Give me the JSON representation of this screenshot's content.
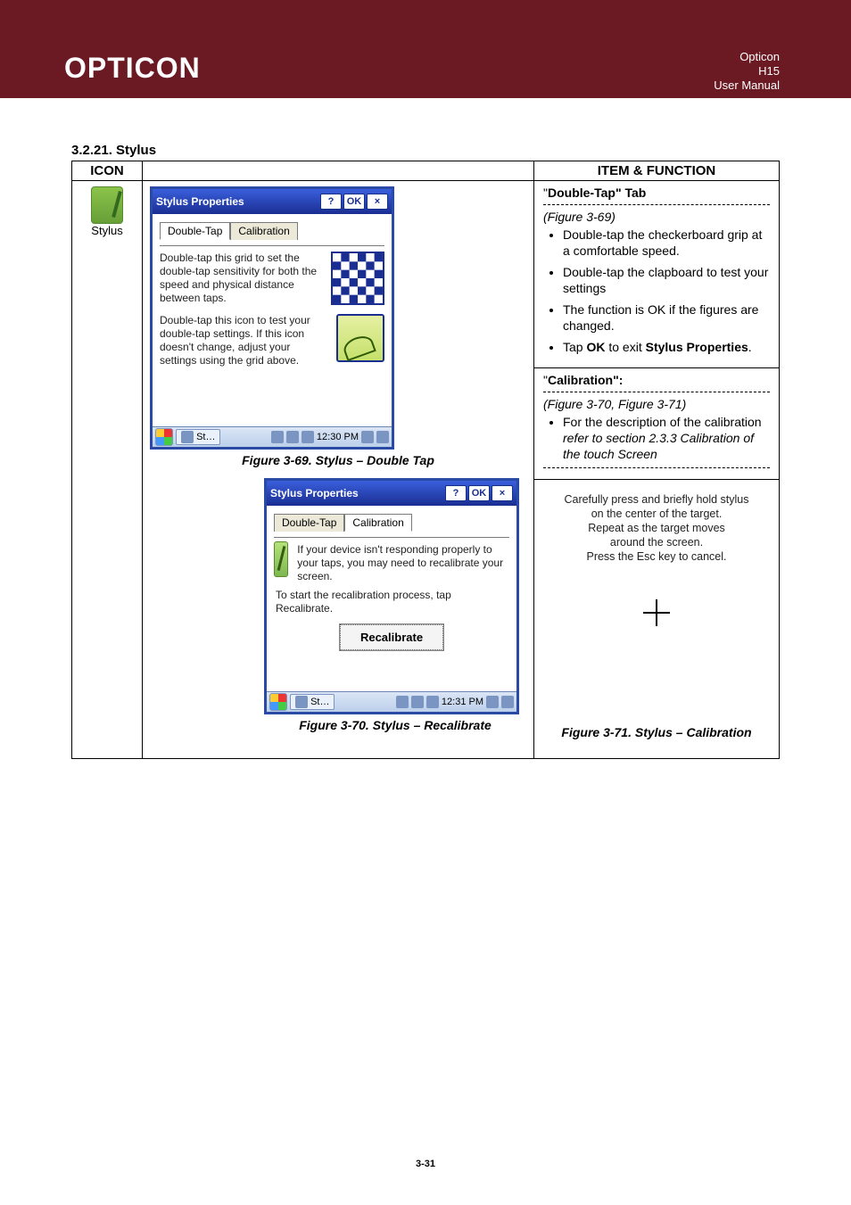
{
  "header": {
    "logo_text": "OPTICON",
    "brand": "Opticon",
    "model": "H15",
    "doc_type": "User Manual"
  },
  "section": {
    "heading": "3.2.21. Stylus"
  },
  "table": {
    "col_icon": "ICON",
    "col_func": "ITEM & FUNCTION",
    "icon_label": "Stylus"
  },
  "fig69": {
    "window_title": "Stylus Properties",
    "help": "?",
    "ok": "OK",
    "close": "×",
    "tab_active": "Double-Tap",
    "tab_inactive": "Calibration",
    "para1": "Double-tap this grid to set the double-tap sensitivity for both the speed and physical distance between taps.",
    "para2": "Double-tap this icon to test your double-tap settings. If this icon doesn't change, adjust your settings using the grid above.",
    "task_label": "St…",
    "task_time": "12:30 PM",
    "caption": "Figure 3-69. Stylus – Double Tap"
  },
  "right_dt": {
    "title_open": "\"",
    "title_strong": "Double-Tap",
    "title_rest": "\" Tab",
    "fig_ref": "(Figure 3-69)",
    "b1": "Double-tap the checkerboard grip at a comfortable speed.",
    "b2": "Double-tap the clapboard to test your settings",
    "b3": "The function is OK if the figures are changed.",
    "b4_pre": "Tap ",
    "b4_ok": "OK",
    "b4_mid": " to exit ",
    "b4_sp": "Stylus Properties",
    "b4_end": "."
  },
  "right_cal": {
    "title_open": "\"",
    "title_strong": "Calibration",
    "title_rest": "\":",
    "fig_ref": "(Figure 3-70, Figure 3-71)",
    "b1_pre": "For the description of the calibration ",
    "b1_it": "refer to section 2.3.3 Calibration of the touch Screen"
  },
  "fig70": {
    "window_title": "Stylus Properties",
    "help": "?",
    "ok": "OK",
    "close": "×",
    "tab_inactive": "Double-Tap",
    "tab_active": "Calibration",
    "memo1": "If your device isn't responding properly to your taps, you may need to recalibrate your screen.",
    "memo2": "To start the recalibration process, tap Recalibrate.",
    "btn": "Recalibrate",
    "task_label": "St…",
    "task_time": "12:31 PM",
    "caption": "Figure 3-70. Stylus – Recalibrate"
  },
  "fig71": {
    "line1": "Carefully press and briefly hold stylus",
    "line2": "on the center of the target.",
    "line3": "Repeat as the target moves",
    "line4": "around the screen.",
    "line5": "Press the Esc key to cancel.",
    "caption": "Figure 3-71. Stylus – Calibration"
  },
  "footer": {
    "page": "3-31"
  }
}
